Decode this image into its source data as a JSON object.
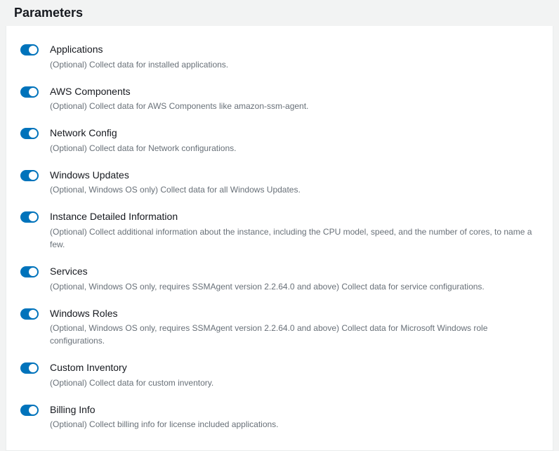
{
  "section": {
    "title": "Parameters"
  },
  "parameters": [
    {
      "name": "applications",
      "label": "Applications",
      "description": "(Optional) Collect data for installed applications.",
      "enabled": true
    },
    {
      "name": "aws-components",
      "label": "AWS Components",
      "description": "(Optional) Collect data for AWS Components like amazon-ssm-agent.",
      "enabled": true
    },
    {
      "name": "network-config",
      "label": "Network Config",
      "description": "(Optional) Collect data for Network configurations.",
      "enabled": true
    },
    {
      "name": "windows-updates",
      "label": "Windows Updates",
      "description": "(Optional, Windows OS only) Collect data for all Windows Updates.",
      "enabled": true
    },
    {
      "name": "instance-detailed-information",
      "label": "Instance Detailed Information",
      "description": "(Optional) Collect additional information about the instance, including the CPU model, speed, and the number of cores, to name a few.",
      "enabled": true
    },
    {
      "name": "services",
      "label": "Services",
      "description": "(Optional, Windows OS only, requires SSMAgent version 2.2.64.0 and above) Collect data for service configurations.",
      "enabled": true
    },
    {
      "name": "windows-roles",
      "label": "Windows Roles",
      "description": "(Optional, Windows OS only, requires SSMAgent version 2.2.64.0 and above) Collect data for Microsoft Windows role configurations.",
      "enabled": true
    },
    {
      "name": "custom-inventory",
      "label": "Custom Inventory",
      "description": "(Optional) Collect data for custom inventory.",
      "enabled": true
    },
    {
      "name": "billing-info",
      "label": "Billing Info",
      "description": "(Optional) Collect billing info for license included applications.",
      "enabled": true
    }
  ]
}
